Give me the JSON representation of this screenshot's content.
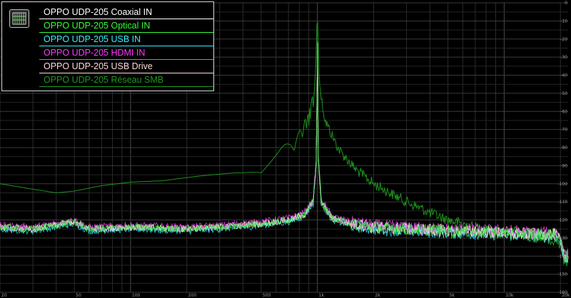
{
  "chart_data": {
    "type": "line",
    "title": "",
    "xlabel": "",
    "ylabel": "",
    "x_scale": "log",
    "xlim": [
      20,
      22000
    ],
    "ylim": [
      -160,
      0
    ],
    "grid": true,
    "legend_position": "top-left",
    "x_tick_labels": [
      "20",
      "50",
      "100",
      "200",
      "500",
      "1k",
      "2k",
      "5k",
      "10k",
      "20k"
    ],
    "y_tick_labels": [
      "0",
      "-10",
      "-20",
      "-30",
      "-40",
      "-50",
      "-60",
      "-70",
      "-80",
      "-90",
      "-100",
      "-110",
      "-120",
      "-130",
      "-140",
      "-150",
      "-160"
    ],
    "series": [
      {
        "name": "OPPO UDP-205 Coaxial IN",
        "color": "#ffffff",
        "points": [
          [
            20,
            -124
          ],
          [
            30,
            -125
          ],
          [
            45,
            -122
          ],
          [
            50,
            -121
          ],
          [
            60,
            -125
          ],
          [
            100,
            -124
          ],
          [
            200,
            -125
          ],
          [
            300,
            -124
          ],
          [
            500,
            -122
          ],
          [
            700,
            -120
          ],
          [
            850,
            -117
          ],
          [
            950,
            -110
          ],
          [
            990,
            -85
          ],
          [
            1000,
            -2
          ],
          [
            1010,
            -85
          ],
          [
            1050,
            -110
          ],
          [
            1200,
            -119
          ],
          [
            1500,
            -122
          ],
          [
            2000,
            -124
          ],
          [
            3000,
            -125
          ],
          [
            5000,
            -126
          ],
          [
            10000,
            -127
          ],
          [
            15000,
            -128
          ],
          [
            19000,
            -128
          ],
          [
            20000,
            -132
          ],
          [
            21000,
            -140
          ]
        ]
      },
      {
        "name": "OPPO UDP-205 Optical IN",
        "color": "#35ff35",
        "points": [
          [
            20,
            -124
          ],
          [
            30,
            -125
          ],
          [
            45,
            -122
          ],
          [
            50,
            -121
          ],
          [
            60,
            -125
          ],
          [
            100,
            -124
          ],
          [
            200,
            -125
          ],
          [
            300,
            -124
          ],
          [
            500,
            -122
          ],
          [
            700,
            -120
          ],
          [
            850,
            -117
          ],
          [
            950,
            -110
          ],
          [
            990,
            -85
          ],
          [
            1000,
            -2
          ],
          [
            1010,
            -85
          ],
          [
            1050,
            -110
          ],
          [
            1200,
            -119
          ],
          [
            1500,
            -122
          ],
          [
            2000,
            -124
          ],
          [
            3000,
            -125
          ],
          [
            5000,
            -126
          ],
          [
            10000,
            -127
          ],
          [
            15000,
            -128
          ],
          [
            19000,
            -128
          ],
          [
            20000,
            -132
          ],
          [
            21000,
            -140
          ]
        ]
      },
      {
        "name": "OPPO UDP-205 USB IN",
        "color": "#35f0ff",
        "points": [
          [
            20,
            -125
          ],
          [
            30,
            -126
          ],
          [
            45,
            -123
          ],
          [
            50,
            -122
          ],
          [
            60,
            -126
          ],
          [
            100,
            -125
          ],
          [
            200,
            -126
          ],
          [
            300,
            -125
          ],
          [
            500,
            -123
          ],
          [
            700,
            -121
          ],
          [
            850,
            -118
          ],
          [
            950,
            -111
          ],
          [
            990,
            -86
          ],
          [
            1000,
            -2
          ],
          [
            1010,
            -86
          ],
          [
            1050,
            -111
          ],
          [
            1200,
            -120
          ],
          [
            1500,
            -123
          ],
          [
            2000,
            -125
          ],
          [
            3000,
            -126
          ],
          [
            5000,
            -127
          ],
          [
            10000,
            -128
          ],
          [
            15000,
            -129
          ],
          [
            19000,
            -129
          ],
          [
            20000,
            -133
          ],
          [
            21000,
            -141
          ]
        ]
      },
      {
        "name": "OPPO UDP-205 HDMI IN",
        "color": "#ff3cff",
        "points": [
          [
            20,
            -123
          ],
          [
            30,
            -124
          ],
          [
            45,
            -121
          ],
          [
            50,
            -120
          ],
          [
            60,
            -124
          ],
          [
            100,
            -123
          ],
          [
            200,
            -124
          ],
          [
            300,
            -123
          ],
          [
            500,
            -121
          ],
          [
            700,
            -119
          ],
          [
            850,
            -116
          ],
          [
            950,
            -109
          ],
          [
            990,
            -84
          ],
          [
            1000,
            -2
          ],
          [
            1010,
            -84
          ],
          [
            1050,
            -109
          ],
          [
            1200,
            -118
          ],
          [
            1500,
            -121
          ],
          [
            2000,
            -123
          ],
          [
            3000,
            -124
          ],
          [
            5000,
            -125
          ],
          [
            10000,
            -126
          ],
          [
            15000,
            -127
          ],
          [
            19000,
            -127
          ],
          [
            20000,
            -131
          ],
          [
            21000,
            -139
          ]
        ]
      },
      {
        "name": "OPPO UDP-205 USB Drive",
        "color": "#ffd8d8",
        "points": [
          [
            20,
            -124
          ],
          [
            30,
            -125
          ],
          [
            45,
            -122
          ],
          [
            50,
            -121
          ],
          [
            60,
            -125
          ],
          [
            100,
            -124
          ],
          [
            200,
            -125
          ],
          [
            300,
            -124
          ],
          [
            500,
            -122
          ],
          [
            700,
            -120
          ],
          [
            850,
            -117
          ],
          [
            950,
            -110
          ],
          [
            990,
            -85
          ],
          [
            1000,
            -2
          ],
          [
            1010,
            -85
          ],
          [
            1050,
            -110
          ],
          [
            1200,
            -119
          ],
          [
            1500,
            -122
          ],
          [
            2000,
            -124
          ],
          [
            3000,
            -125
          ],
          [
            5000,
            -126
          ],
          [
            10000,
            -127
          ],
          [
            15000,
            -128
          ],
          [
            19000,
            -128
          ],
          [
            20000,
            -132
          ],
          [
            21000,
            -140
          ]
        ]
      },
      {
        "name": "OPPO UDP-205 Réseau SMB",
        "color": "#1f9a1f",
        "points": [
          [
            20,
            -100
          ],
          [
            30,
            -103
          ],
          [
            40,
            -105
          ],
          [
            50,
            -104
          ],
          [
            70,
            -101
          ],
          [
            100,
            -99
          ],
          [
            150,
            -98
          ],
          [
            200,
            -96
          ],
          [
            300,
            -93
          ],
          [
            400,
            -90
          ],
          [
            500,
            -86
          ],
          [
            600,
            -82
          ],
          [
            700,
            -77
          ],
          [
            800,
            -71
          ],
          [
            900,
            -60
          ],
          [
            950,
            -50
          ],
          [
            980,
            -35
          ],
          [
            1000,
            -2
          ],
          [
            1020,
            -35
          ],
          [
            1050,
            -50
          ],
          [
            1100,
            -62
          ],
          [
            1300,
            -78
          ],
          [
            1600,
            -89
          ],
          [
            2000,
            -97
          ],
          [
            3000,
            -107
          ],
          [
            4000,
            -113
          ],
          [
            5000,
            -117
          ],
          [
            7000,
            -121
          ],
          [
            10000,
            -124
          ],
          [
            15000,
            -127
          ],
          [
            19000,
            -128
          ],
          [
            20000,
            -131
          ],
          [
            21000,
            -140
          ]
        ]
      }
    ]
  }
}
